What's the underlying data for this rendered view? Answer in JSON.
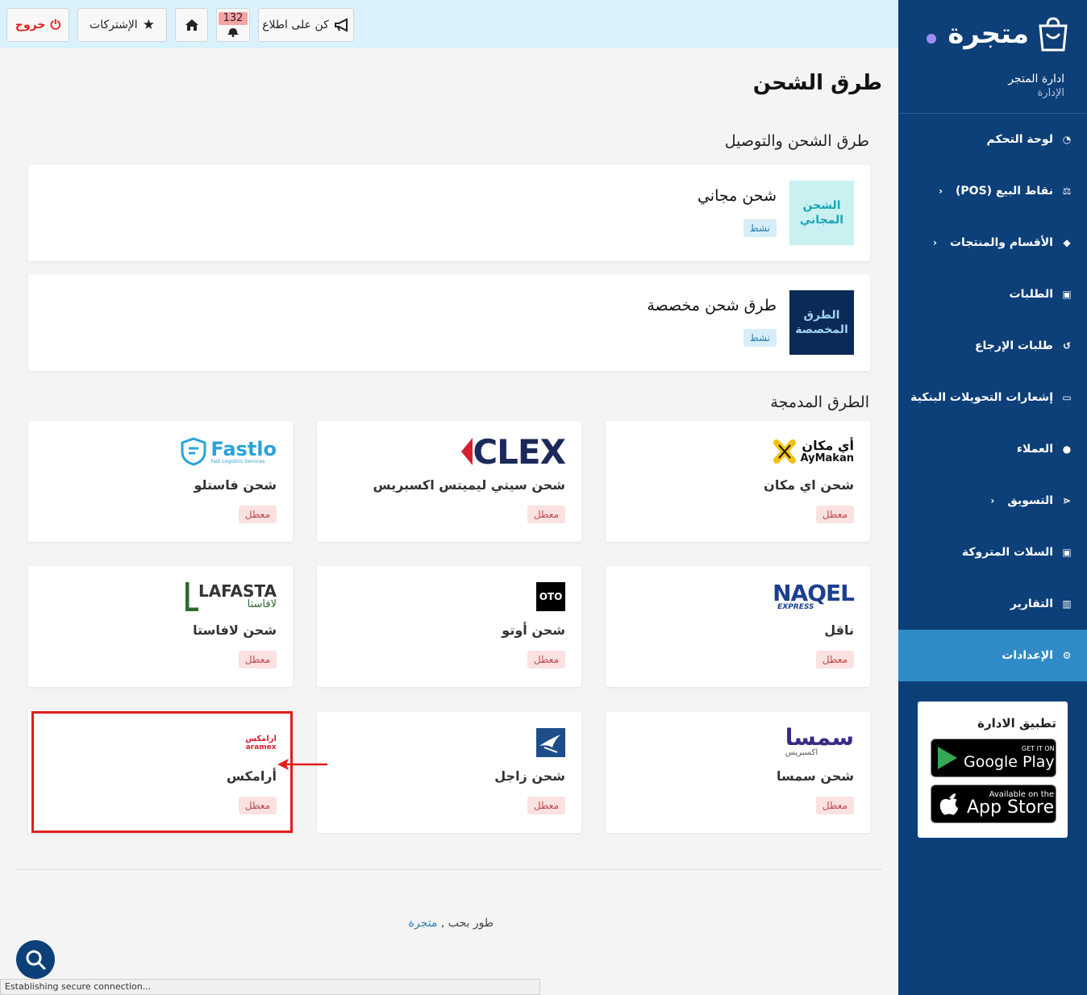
{
  "topbar": {
    "logout_label": "خروج",
    "subscriptions_label": "الإشتركات",
    "notifications_count": "132",
    "stay_informed_label": "كن على اطلاع"
  },
  "sidebar": {
    "brand_name": "متجرة",
    "store_name": "ادارة المتجر",
    "store_role": "الإدارة",
    "items": [
      {
        "label": "لوحة التحكم",
        "icon": "dashboard-icon"
      },
      {
        "label": "نقاط البيع (POS)",
        "icon": "scale-icon",
        "chevron": "‹"
      },
      {
        "label": "الأقسام والمنتجات",
        "icon": "tag-icon",
        "chevron": "‹"
      },
      {
        "label": "الطلبات",
        "icon": "cart-icon"
      },
      {
        "label": "طلبات الإرجاع",
        "icon": "undo-icon"
      },
      {
        "label": "إشعارات التحويلات البنكية",
        "icon": "money-icon"
      },
      {
        "label": "العملاء",
        "icon": "user-icon"
      },
      {
        "label": "التسويق",
        "icon": "share-icon",
        "chevron": "‹"
      },
      {
        "label": "السلات المتروكة",
        "icon": "cart-icon"
      },
      {
        "label": "التقارير",
        "icon": "chart-icon"
      },
      {
        "label": "الإعدادات",
        "icon": "gear-icon"
      }
    ],
    "app_box": {
      "title": "تطبيق الادارة",
      "google_small": "GET IT ON",
      "google_big": "Google Play",
      "apple_small": "Available on the",
      "apple_big": "App Store"
    }
  },
  "main": {
    "page_title": "طرق الشحن",
    "section_shipping": "طرق الشحن والتوصيل",
    "section_integrated": "الطرق المدمجة",
    "wide_cards": [
      {
        "logo_text": "الشحن المجاني",
        "name": "شحن مجاني",
        "status": "نشط"
      },
      {
        "logo_text": "الطرق المخصصة",
        "name": "طرق شحن مخصصة",
        "status": "نشط"
      }
    ],
    "cards": [
      {
        "logo": "أي مكان AyMakan",
        "logo_ar": "أي مكان",
        "logo_en": "AyMakan",
        "name": "شحن اي مكان",
        "status": "معطل"
      },
      {
        "logo": "CLEX",
        "name": "شحن سيتي ليميتس اكسبريس",
        "status": "معطل"
      },
      {
        "logo": "Fastlo",
        "logo_sub": "Fast Logistics Services",
        "name": "شحن فاستلو",
        "status": "معطل"
      },
      {
        "logo": "NAQEL",
        "logo_sub": "EXPRESS",
        "name": "ناقل",
        "status": "معطل"
      },
      {
        "logo": "OTO",
        "name": "شحن أوتو",
        "status": "معطل"
      },
      {
        "logo": "LAFASTA",
        "logo_ar": "لافاستا",
        "name": "شحن لافاستا",
        "status": "معطل"
      },
      {
        "logo": "سمسا",
        "logo_sub": "اكسبريس",
        "name": "شحن سمسا",
        "status": "معطل"
      },
      {
        "logo": "zajil",
        "name": "شحن زاجل",
        "status": "معطل"
      },
      {
        "logo": "aramex",
        "logo_ar": "ارامكس",
        "name": "أرامكس",
        "status": "معطل"
      }
    ],
    "footer_text": "طور بحب ,",
    "footer_link": "متجرة"
  },
  "status_bar": "Establishing secure connection...",
  "colors": {
    "sidebar_bg": "#0d3f78",
    "active_item": "#2f8bc6",
    "topbar_bg": "#d9f2fb",
    "highlight": "#e01e1e",
    "logout_red": "#e01e1e"
  }
}
